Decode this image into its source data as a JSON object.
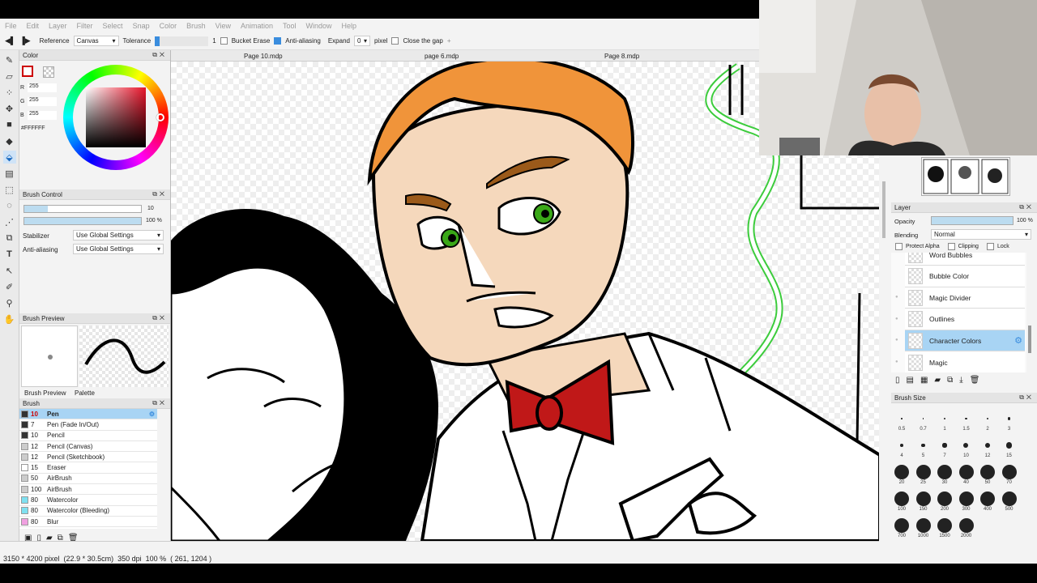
{
  "menu": [
    "File",
    "Edit",
    "Layer",
    "Filter",
    "Select",
    "Snap",
    "Color",
    "Brush",
    "View",
    "Animation",
    "Tool",
    "Window",
    "Help"
  ],
  "toolbar": {
    "reference_label": "Reference",
    "reference_value": "Canvas",
    "tolerance_label": "Tolerance",
    "tolerance_value": "1",
    "bucket_erase": "Bucket Erase",
    "anti_aliasing": "Anti-aliasing",
    "expand_label": "Expand",
    "expand_value": "0",
    "expand_unit": "pixel",
    "close_gap": "Close the gap",
    "plus": "+"
  },
  "tabs": [
    "Page 10.mdp",
    "page 6.mdp",
    "Page 8.mdp"
  ],
  "color_panel": {
    "title": "Color",
    "r_label": "R",
    "r": "255",
    "g_label": "G",
    "g": "255",
    "b_label": "B",
    "b": "255",
    "hex": "#FFFFFF"
  },
  "brush_control": {
    "title": "Brush Control",
    "size": "10",
    "opacity": "100 %",
    "stabilizer_label": "Stabilizer",
    "stabilizer_value": "Use Global Settings",
    "aa_label": "Anti-aliasing",
    "aa_value": "Use Global Settings"
  },
  "brush_preview": {
    "title": "Brush Preview",
    "tab1": "Brush Preview",
    "tab2": "Palette"
  },
  "brush_panel": {
    "title": "Brush",
    "items": [
      {
        "size": "10",
        "name": "Pen",
        "color": "#333333"
      },
      {
        "size": "7",
        "name": "Pen (Fade In/Out)",
        "color": "#333333"
      },
      {
        "size": "10",
        "name": "Pencil",
        "color": "#333333"
      },
      {
        "size": "12",
        "name": "Pencil (Canvas)",
        "color": "#cccccc"
      },
      {
        "size": "12",
        "name": "Pencil (Sketchbook)",
        "color": "#cccccc"
      },
      {
        "size": "15",
        "name": "Eraser",
        "color": "#ffffff"
      },
      {
        "size": "50",
        "name": "AirBrush",
        "color": "#cccccc"
      },
      {
        "size": "100",
        "name": "AirBrush",
        "color": "#cccccc"
      },
      {
        "size": "80",
        "name": "Watercolor",
        "color": "#7fe0f0"
      },
      {
        "size": "80",
        "name": "Watercolor (Bleeding)",
        "color": "#7fe0f0"
      },
      {
        "size": "80",
        "name": "Blur",
        "color": "#f0a0e0"
      }
    ]
  },
  "status": "3150 * 4200 pixel  (22.9 * 30.5cm)  350 dpi  100 %  ( 261, 1204 )",
  "layer_panel": {
    "title": "Layer",
    "opacity_label": "Opacity",
    "opacity": "100 %",
    "blending_label": "Blending",
    "blending": "Normal",
    "protect_alpha": "Protect Alpha",
    "clipping": "Clipping",
    "lock": "Lock",
    "layers": [
      "Word Bubbles",
      "Bubble Color",
      "Magic Divider",
      "Outlines",
      "Character Colors",
      "Magic"
    ]
  },
  "brush_size": {
    "title": "Brush Size",
    "sizes": [
      "0.5",
      "0.7",
      "1",
      "1.5",
      "2",
      "3",
      "4",
      "5",
      "7",
      "10",
      "12",
      "15",
      "20",
      "25",
      "30",
      "40",
      "50",
      "70",
      "100",
      "150",
      "200",
      "300",
      "400",
      "500",
      "700",
      "1000",
      "1500",
      "2000"
    ]
  },
  "colors": {
    "accent": "#3a8dde",
    "hair": "#f0943a",
    "skin": "#f5d8bc",
    "eyes": "#3aa818",
    "bow": "#c01818",
    "magic": "#3ccc3c"
  }
}
